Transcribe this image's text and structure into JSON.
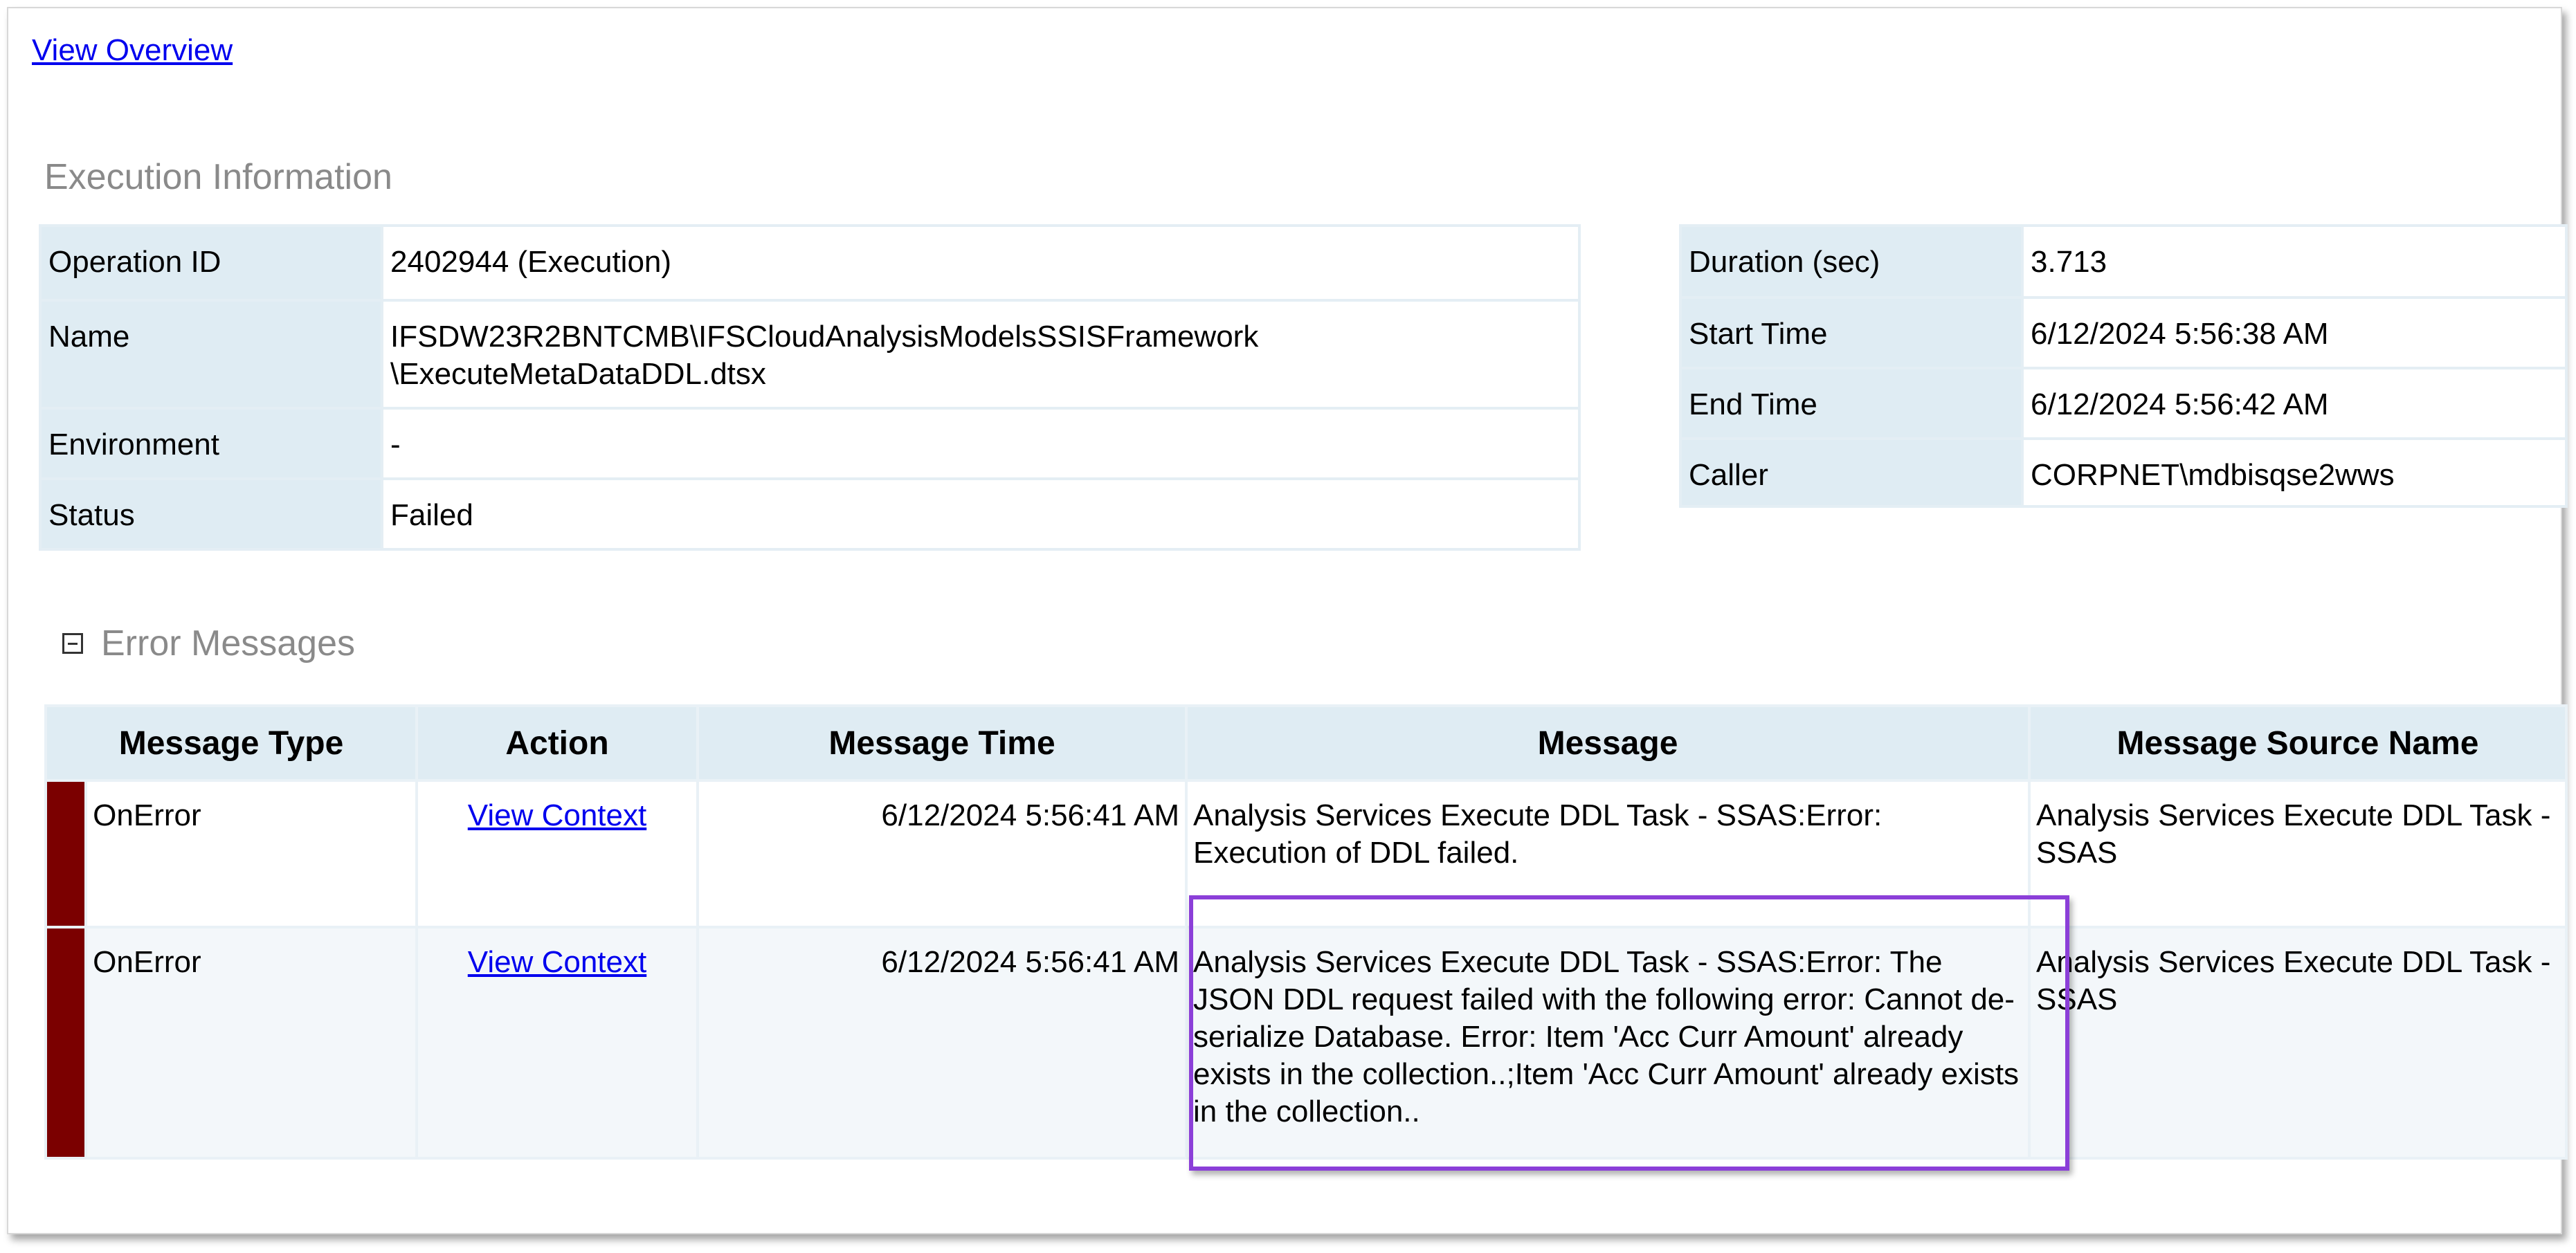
{
  "nav": {
    "view_overview": "View Overview"
  },
  "execution_info": {
    "title": "Execution Information",
    "left": [
      {
        "label": "Operation ID",
        "value": "2402944 (Execution)"
      },
      {
        "label": "Name",
        "value": "IFSDW23R2BNTCMB\\IFSCloudAnalysisModelsSSISFramework\n\\ExecuteMetaDataDDL.dtsx"
      },
      {
        "label": "Environment",
        "value": "-"
      },
      {
        "label": "Status",
        "value": "Failed"
      }
    ],
    "right": [
      {
        "label": "Duration (sec)",
        "value": "3.713"
      },
      {
        "label": "Start Time",
        "value": "6/12/2024 5:56:38 AM"
      },
      {
        "label": "End Time",
        "value": "6/12/2024 5:56:42 AM"
      },
      {
        "label": "Caller",
        "value": "CORPNET\\mdbisqse2wws"
      }
    ]
  },
  "error_messages": {
    "title": "Error Messages",
    "columns": [
      "Message Type",
      "Action",
      "Message Time",
      "Message",
      "Message Source Name"
    ],
    "rows": [
      {
        "type": "OnError",
        "action": "View Context",
        "time": "6/12/2024 5:56:41 AM",
        "message": "Analysis Services Execute DDL Task - SSAS:Error: Execution of DDL failed.",
        "source": "Analysis Services Execute DDL Task - SSAS"
      },
      {
        "type": "OnError",
        "action": "View Context",
        "time": "6/12/2024 5:56:41 AM",
        "message": "Analysis Services Execute DDL Task - SSAS:Error: The JSON DDL request failed with the following error: Cannot de-serialize Database. Error: Item 'Acc Curr Amount' already exists in the collection..;Item 'Acc Curr Amount' already exists in the collection..",
        "source": "Analysis Services Execute DDL Task - SSAS"
      }
    ]
  },
  "colors": {
    "error_marker": "#7b0000",
    "highlight": "#8b3fd8",
    "header_bg": "#dfecf3"
  }
}
